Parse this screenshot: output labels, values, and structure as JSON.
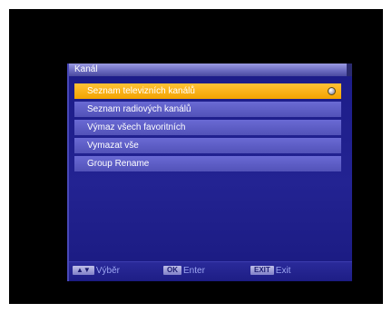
{
  "window": {
    "title": "Kanál"
  },
  "menu": {
    "items": [
      {
        "label": "Seznam televizních kanálů",
        "selected": true
      },
      {
        "label": "Seznam radiových kanálů",
        "selected": false
      },
      {
        "label": "Výmaz všech favoritních",
        "selected": false
      },
      {
        "label": "Vymazat vše",
        "selected": false
      },
      {
        "label": "Group Rename",
        "selected": false
      }
    ]
  },
  "footer": {
    "nav": {
      "key": "▲▼",
      "label": "Výběr"
    },
    "ok": {
      "key": "OK",
      "label": "Enter"
    },
    "exit": {
      "key": "EXIT",
      "label": "Exit"
    }
  },
  "colors": {
    "panel": "#232392",
    "item": "#5e5ec6",
    "selected": "#ffb000",
    "title_bar": "#7a7acc"
  },
  "icons": {
    "selected_marker": "radio-dot-icon"
  }
}
